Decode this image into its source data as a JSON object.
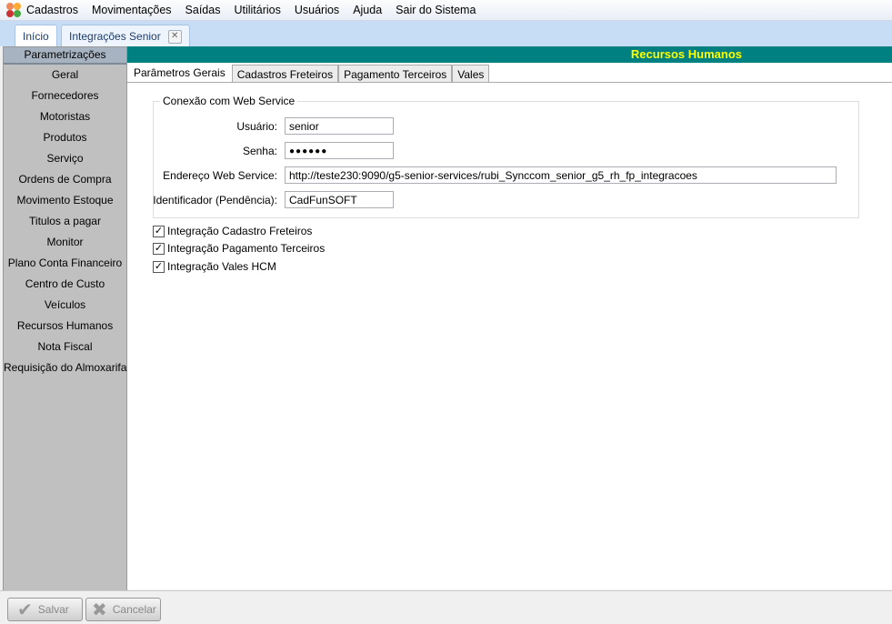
{
  "menu": [
    "Cadastros",
    "Movimentações",
    "Saídas",
    "Utilitários",
    "Usuários",
    "Ajuda",
    "Sair do Sistema"
  ],
  "doc_tabs": [
    "Início",
    "Integrações Senior"
  ],
  "sidebar": {
    "header": "Parametrizações",
    "items": [
      "Geral",
      "Fornecedores",
      "Motoristas",
      "Produtos",
      "Serviço",
      "Ordens de Compra",
      "Movimento Estoque",
      "Titulos a pagar",
      "Monitor",
      "Plano Conta Financeiro",
      "Centro de Custo",
      "Veículos",
      "Recursos Humanos",
      "Nota Fiscal",
      "Requisição do Almoxarifado"
    ]
  },
  "banner": "Recursos Humanos",
  "tabs": [
    "Parâmetros Gerais",
    "Cadastros Freteiros",
    "Pagamento Terceiros",
    "Vales"
  ],
  "group": {
    "title": "Conexão com Web Service",
    "fields": [
      {
        "label": "Usuário:",
        "value": "senior"
      },
      {
        "label": "Senha:",
        "value": "●●●●●●"
      },
      {
        "label": "Endereço Web Service:",
        "value": "http://teste230:9090/g5-senior-services/rubi_Synccom_senior_g5_rh_fp_integracoes"
      },
      {
        "label": "Identificador (Pendência):",
        "value": "CadFunSOFT"
      }
    ]
  },
  "checks": [
    "Integração Cadastro Freteiros",
    "Integração Pagamento Terceiros",
    "Integração Vales HCM"
  ],
  "buttons": {
    "save": "Salvar",
    "cancel": "Cancelar"
  }
}
